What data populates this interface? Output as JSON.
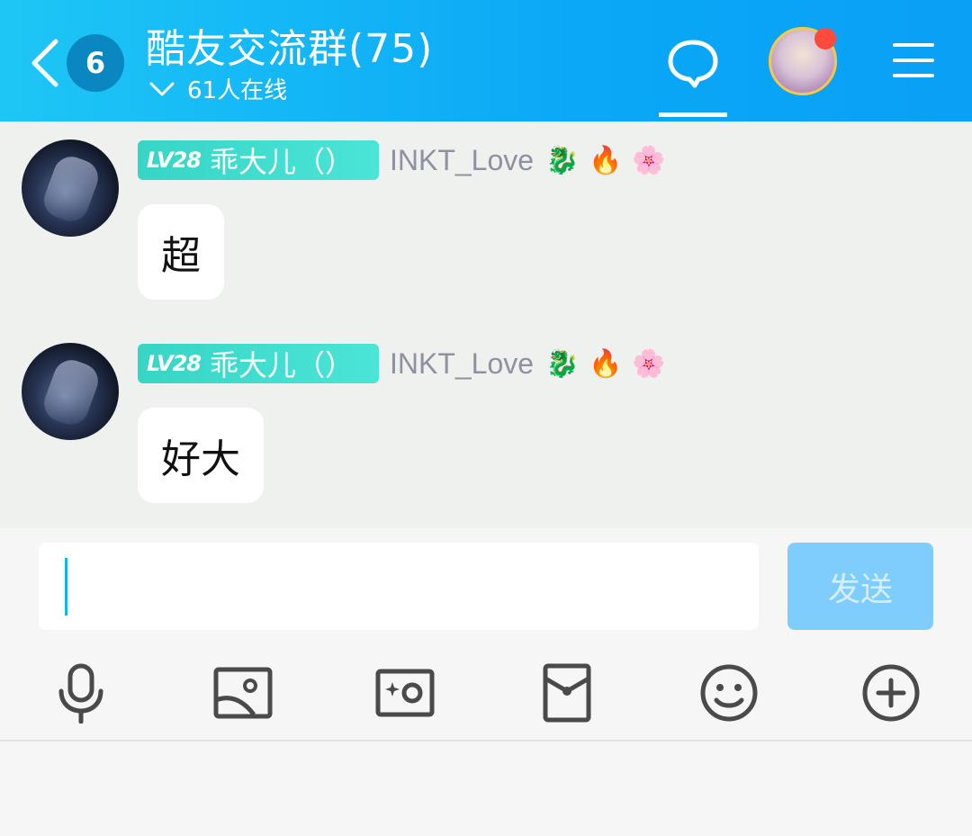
{
  "header": {
    "back_badge": "6",
    "title": "酷友交流群(75)",
    "online_text": "61人在线"
  },
  "messages": [
    {
      "level_label": "LV28",
      "title_tag": "乖大儿（）",
      "username": "INKT_Love",
      "badge_icons": [
        "dragon-badge-icon",
        "fire-badge-icon",
        "flower-face-badge-icon"
      ],
      "text": "超"
    },
    {
      "level_label": "LV28",
      "title_tag": "乖大儿（）",
      "username": "INKT_Love",
      "badge_icons": [
        "dragon-badge-icon",
        "fire-badge-icon",
        "flower-face-badge-icon"
      ],
      "text": "好大"
    }
  ],
  "composer": {
    "value": "",
    "send_label": "发送"
  },
  "toolbar": {
    "icons": [
      "microphone-icon",
      "image-icon",
      "camera-icon",
      "red-packet-icon",
      "emoji-icon",
      "plus-circle-icon"
    ]
  },
  "colors": {
    "header_gradient_start": "#1ec6f5",
    "header_gradient_end": "#0aa0f5",
    "send_button": "#7fcdfd",
    "level_tag": "#37d5c6",
    "notification_dot": "#ff4a3d"
  }
}
